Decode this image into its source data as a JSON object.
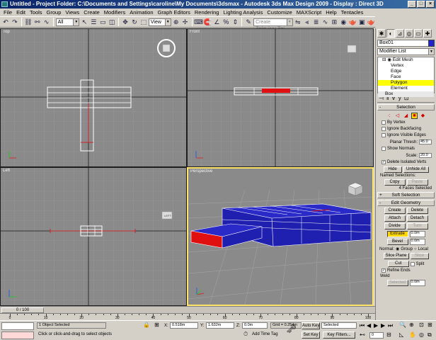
{
  "window": {
    "title": "Untitled    - Project Folder: C:\\Documents and Settings\\caroline\\My Documents\\3dsmax      - Autodesk 3ds Max Design 2009      - Display : Direct 3D",
    "buttons": [
      "_",
      "□",
      "×"
    ]
  },
  "menu": [
    "File",
    "Edit",
    "Tools",
    "Group",
    "Views",
    "Create",
    "Modifiers",
    "Animation",
    "Graph Editors",
    "Rendering",
    "Lighting Analysis",
    "Customize",
    "MAXScript",
    "Help",
    "Tentacles"
  ],
  "toolbar": {
    "selection_filter": "All",
    "reference_coord": "View",
    "named_selection_placeholder": "Create Selection Set"
  },
  "viewports": {
    "top": "Top",
    "front": "Front",
    "left": "Left",
    "perspective": "Perspective",
    "gizmo_left": "LEFT"
  },
  "command_panel": {
    "object_name": "Box01",
    "object_color": "#2222cc",
    "modifier_list": "Modifier List",
    "stack": {
      "root": "Edit Mesh",
      "subs": [
        "Vertex",
        "Edge",
        "Face",
        "Polygon",
        "Element"
      ],
      "selected": "Polygon",
      "base": "Box"
    },
    "selection": {
      "title": "Selection",
      "by_vertex": "By Vertex",
      "ignore_backfacing": "Ignore Backfacing",
      "ignore_visible_edges": "Ignore Visible Edges",
      "planar_thresh_label": "Planar Thresh:",
      "planar_thresh_value": "45.0",
      "show_normals": "Show Normals",
      "scale_label": "Scale:",
      "scale_value": "20.0",
      "delete_isolated": "Delete Isolated Verts",
      "hide": "Hide",
      "unhide_all": "Unhide All",
      "named_selections": "Named Selections:",
      "copy": "Copy",
      "paste": "Paste",
      "status": "4 Faces Selected"
    },
    "soft_selection": {
      "title": "Soft Selection"
    },
    "edit_geometry": {
      "title": "Edit Geometry",
      "create": "Create",
      "delete": "Delete",
      "attach": "Attach",
      "detach": "Detach",
      "divide": "Divide",
      "turn": "Turn",
      "extrude": "Extrude",
      "extrude_value": "0.0m",
      "bevel": "Bevel",
      "bevel_value": "0.0m",
      "normal_label": "Normal:",
      "group": "Group",
      "local": "Local",
      "slice_plane": "Slice Plane",
      "slice": "Slice",
      "cut": "Cut",
      "split": "Split",
      "refine_ends": "Refine Ends",
      "weld": "Weld",
      "selected": "Selected",
      "selected_value": "0.0m"
    }
  },
  "timeline": {
    "frame": "0 / 100",
    "ticks": [
      "0",
      "10",
      "20",
      "30",
      "40",
      "50",
      "60",
      "70",
      "80",
      "90",
      "100"
    ]
  },
  "status": {
    "objects_selected": "1 Object Selected",
    "prompt": "Click or click-and-drag to select objects",
    "x_label": "X:",
    "x_value": "0.518m",
    "y_label": "Y:",
    "y_value": "1.632m",
    "z_label": "Z:",
    "z_value": "0.0m",
    "grid": "Grid = 0.254m",
    "add_time_tag": "Add Time Tag",
    "auto_key": "Auto Key",
    "auto_key_mode": "Selected",
    "set_key": "Set Key",
    "key_filters": "Key Filters...",
    "frame_field": "0"
  }
}
